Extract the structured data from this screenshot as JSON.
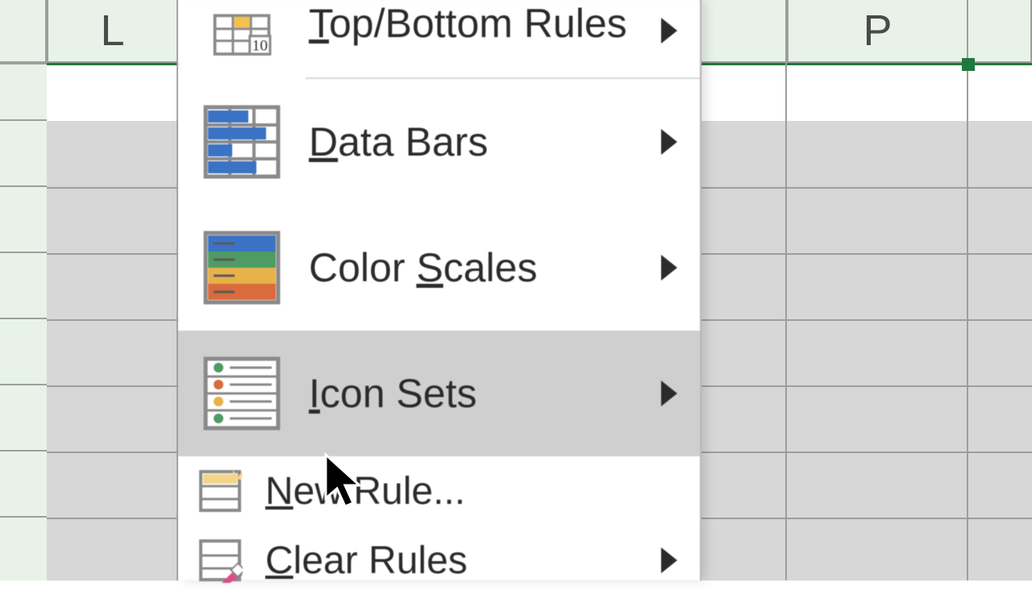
{
  "columns": {
    "L": "L",
    "P": "P"
  },
  "menu": {
    "topBottom": {
      "pre": "",
      "u": "T",
      "post": "op/Bottom Rules"
    },
    "dataBars": {
      "pre": "",
      "u": "D",
      "post": "ata Bars"
    },
    "colorScales": {
      "pre": "Color ",
      "u": "S",
      "post": "cales"
    },
    "iconSets": {
      "pre": "",
      "u": "I",
      "post": "con Sets"
    },
    "newRule": {
      "pre": "",
      "u": "N",
      "post": "ew Rule..."
    },
    "clearRules": {
      "pre": "",
      "u": "C",
      "post": "lear Rules"
    }
  }
}
